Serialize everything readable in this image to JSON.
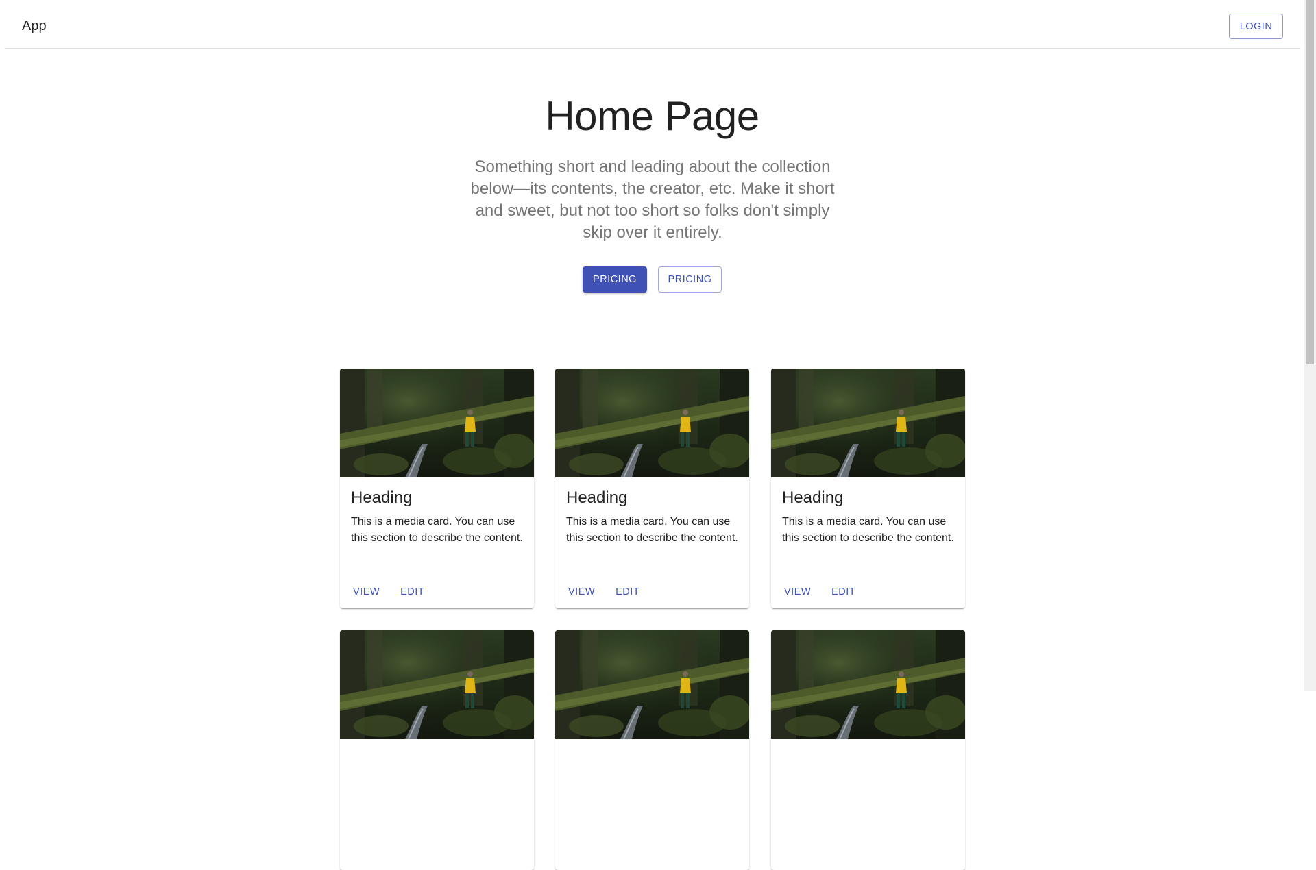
{
  "appbar": {
    "title": "App",
    "login_label": "LOGIN"
  },
  "hero": {
    "title": "Home Page",
    "subtitle": "Something short and leading about the collection below—its contents, the creator, etc. Make it short and sweet, but not too short so folks don't simply skip over it entirely.",
    "primary_button": "PRICING",
    "secondary_button": "PRICING"
  },
  "cards": [
    {
      "heading": "Heading",
      "text": "This is a media card. You can use this section to describe the content.",
      "view": "VIEW",
      "edit": "EDIT"
    },
    {
      "heading": "Heading",
      "text": "This is a media card. You can use this section to describe the content.",
      "view": "VIEW",
      "edit": "EDIT"
    },
    {
      "heading": "Heading",
      "text": "This is a media card. You can use this section to describe the content.",
      "view": "VIEW",
      "edit": "EDIT"
    },
    {
      "heading": "",
      "text": "",
      "view": "",
      "edit": ""
    },
    {
      "heading": "",
      "text": "",
      "view": "",
      "edit": ""
    },
    {
      "heading": "",
      "text": "",
      "view": "",
      "edit": ""
    }
  ],
  "colors": {
    "primary": "#3f51b5",
    "subtitle": "#757575",
    "text": "#212121"
  },
  "icons": {
    "card_media": "forest-photo-image"
  }
}
